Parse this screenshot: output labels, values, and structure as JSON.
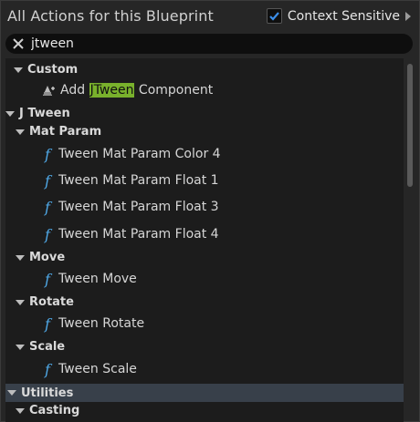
{
  "header": {
    "title": "All Actions for this Blueprint",
    "context_sensitive_label": "Context Sensitive",
    "context_sensitive_checked": true
  },
  "search": {
    "value": "jtween",
    "clear_icon": "close-icon"
  },
  "tree": {
    "custom": {
      "label": "Custom",
      "item_prefix": "Add ",
      "item_highlight": "JTween",
      "item_suffix": " Component"
    },
    "jtween": {
      "label": "J Tween"
    },
    "mat_param": {
      "label": "Mat Param",
      "items": [
        "Tween Mat Param Color 4",
        "Tween Mat Param Float 1",
        "Tween Mat Param Float 3",
        "Tween Mat Param Float 4"
      ]
    },
    "move": {
      "label": "Move",
      "items": [
        "Tween Move"
      ]
    },
    "rotate": {
      "label": "Rotate",
      "items": [
        "Tween Rotate"
      ]
    },
    "scale": {
      "label": "Scale",
      "items": [
        "Tween Scale"
      ]
    },
    "utilities": {
      "label": "Utilities"
    },
    "casting": {
      "label": "Casting"
    }
  },
  "colors": {
    "function_icon": "#4fa8e6",
    "highlight": "#79b12c",
    "selected_row": "#38404a",
    "checkbox_check": "#3b8eea"
  }
}
